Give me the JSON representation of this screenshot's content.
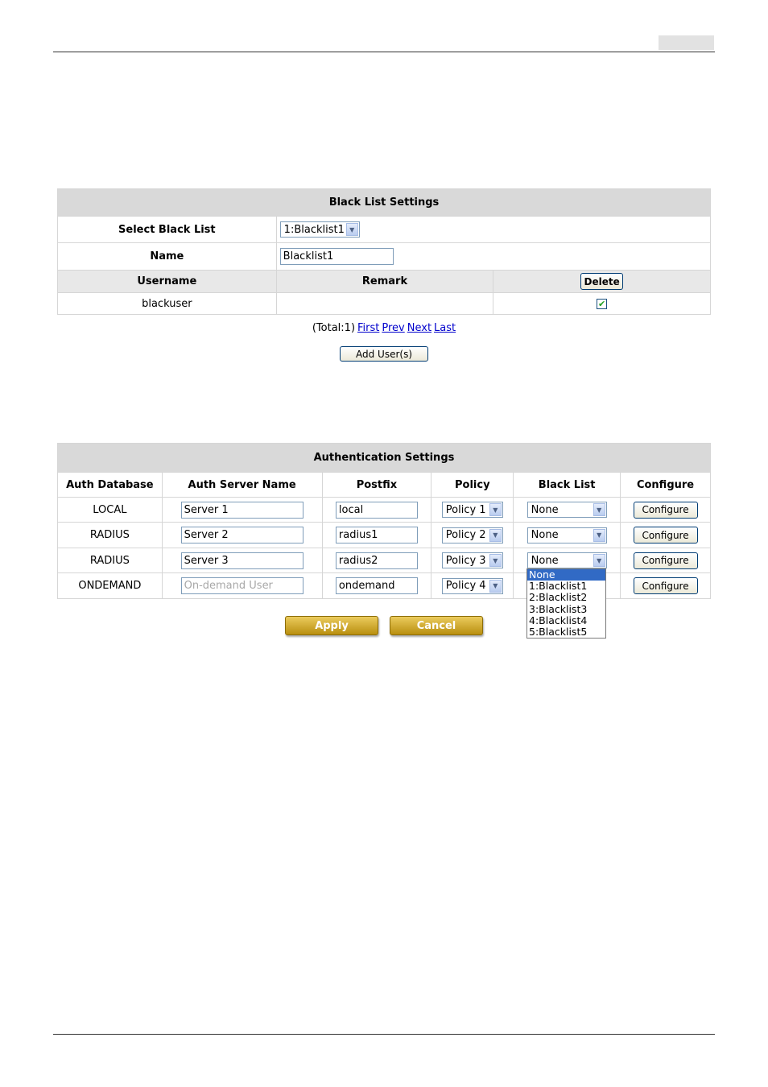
{
  "blacklist_settings": {
    "title": "Black List Settings",
    "select_label": "Select Black List",
    "select_value": "1:Blacklist1",
    "name_label": "Name",
    "name_value": "Blacklist1",
    "col_username": "Username",
    "col_remark": "Remark",
    "delete_label": "Delete",
    "rows": [
      {
        "username": "blackuser",
        "remark": "",
        "checked": true
      }
    ],
    "pager": {
      "total": "(Total:1)",
      "first": "First",
      "prev": "Prev",
      "next": "Next",
      "last": "Last"
    },
    "add_users_label": "Add User(s)"
  },
  "auth_settings": {
    "title": "Authentication Settings",
    "columns": [
      "Auth Database",
      "Auth Server Name",
      "Postfix",
      "Policy",
      "Black List",
      "Configure"
    ],
    "rows": [
      {
        "database": "LOCAL",
        "server_name": "Server 1",
        "postfix": "local",
        "policy": "Policy 1",
        "blacklist": "None",
        "configure": "Configure"
      },
      {
        "database": "RADIUS",
        "server_name": "Server 2",
        "postfix": "radius1",
        "policy": "Policy 2",
        "blacklist": "None",
        "configure": "Configure"
      },
      {
        "database": "RADIUS",
        "server_name": "Server 3",
        "postfix": "radius2",
        "policy": "Policy 3",
        "blacklist": "None",
        "configure": "Configure"
      },
      {
        "database": "ONDEMAND",
        "server_name_placeholder": "On-demand User",
        "postfix": "ondemand",
        "policy": "Policy 4",
        "blacklist": "",
        "configure": "Configure"
      }
    ],
    "blacklist_options": [
      "None",
      "1:Blacklist1",
      "2:Blacklist2",
      "3:Blacklist3",
      "4:Blacklist4",
      "5:Blacklist5"
    ],
    "apply_label": "Apply",
    "cancel_label": "Cancel"
  },
  "icons": {
    "dropdown_arrow": "chevron-down-icon",
    "checkbox_mark": "check-icon"
  },
  "colors": {
    "header_bg": "#d9d9d9",
    "gold_button": "#c9a21e",
    "link": "#0000cc",
    "selected_option": "#316ac5"
  }
}
